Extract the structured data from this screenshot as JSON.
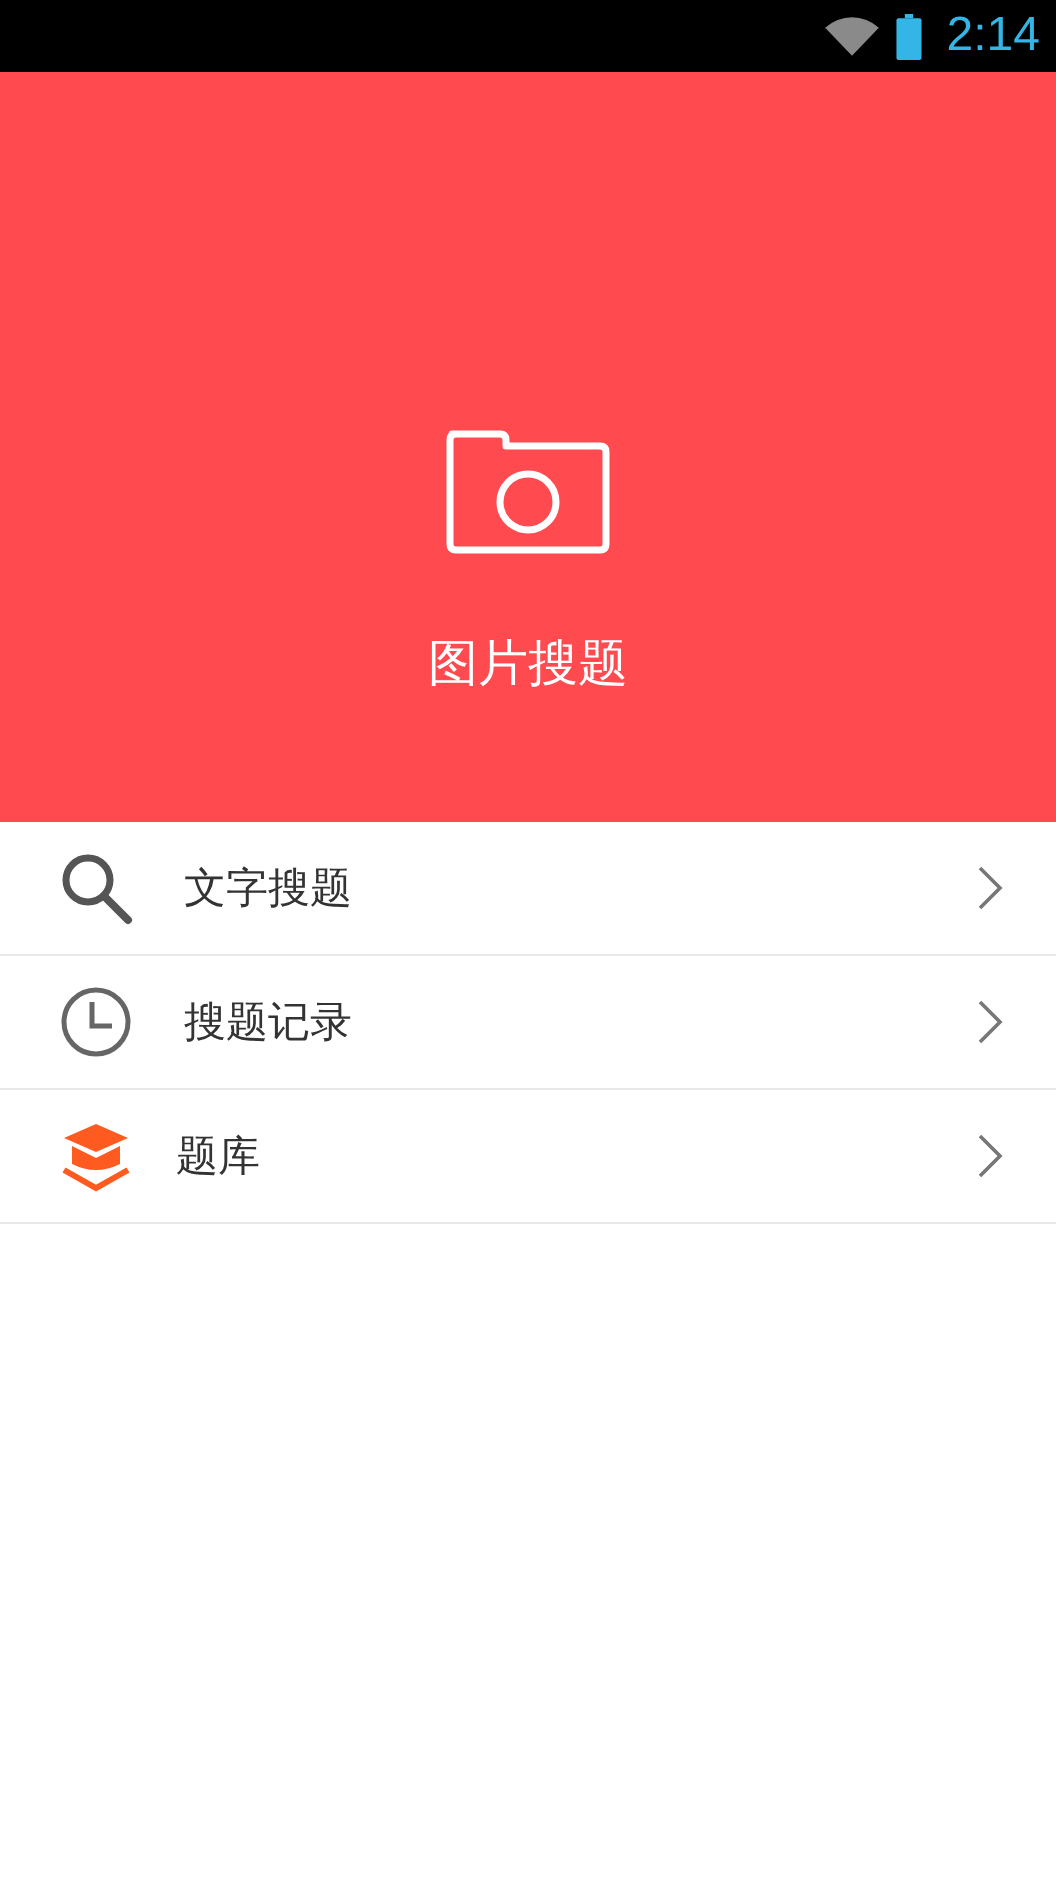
{
  "status_bar": {
    "time": "2:14"
  },
  "hero": {
    "label": "图片搜题"
  },
  "menu": [
    {
      "kind": "search",
      "label": "文字搜题"
    },
    {
      "kind": "history",
      "label": "搜题记录"
    },
    {
      "kind": "library",
      "label": "题库"
    }
  ]
}
